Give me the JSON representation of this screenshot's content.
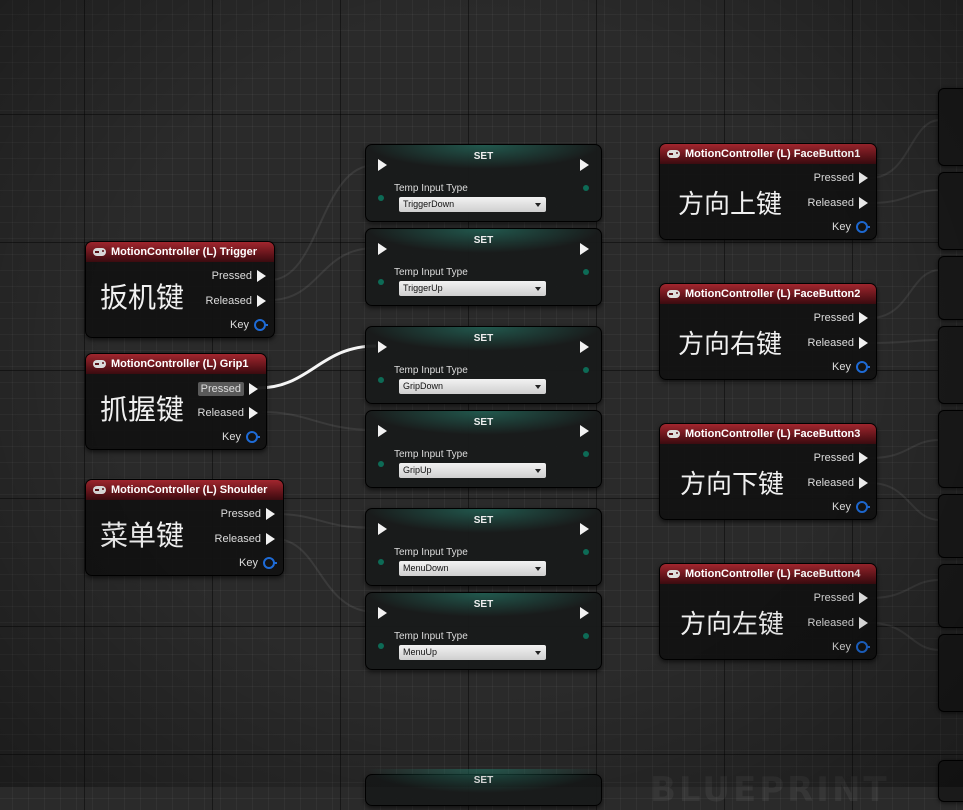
{
  "events": [
    {
      "title": "MotionController (L) Trigger",
      "comment": "扳机键",
      "pins": [
        "Pressed",
        "Released",
        "Key"
      ]
    },
    {
      "title": "MotionController (L) Grip1",
      "comment": "抓握键",
      "pins": [
        "Pressed",
        "Released",
        "Key"
      ]
    },
    {
      "title": "MotionController (L) Shoulder",
      "comment": "菜单键",
      "pins": [
        "Pressed",
        "Released",
        "Key"
      ]
    },
    {
      "title": "MotionController (L) FaceButton1",
      "comment": "方向上键",
      "pins": [
        "Pressed",
        "Released",
        "Key"
      ]
    },
    {
      "title": "MotionController (L) FaceButton2",
      "comment": "方向右键",
      "pins": [
        "Pressed",
        "Released",
        "Key"
      ]
    },
    {
      "title": "MotionController (L) FaceButton3",
      "comment": "方向下键",
      "pins": [
        "Pressed",
        "Released",
        "Key"
      ]
    },
    {
      "title": "MotionController (L) FaceButton4",
      "comment": "方向左键",
      "pins": [
        "Pressed",
        "Released",
        "Key"
      ]
    }
  ],
  "set_nodes": [
    {
      "title": "SET",
      "label": "Temp Input Type",
      "value": "TriggerDown"
    },
    {
      "title": "SET",
      "label": "Temp Input Type",
      "value": "TriggerUp"
    },
    {
      "title": "SET",
      "label": "Temp Input Type",
      "value": "GripDown"
    },
    {
      "title": "SET",
      "label": "Temp Input Type",
      "value": "GripUp"
    },
    {
      "title": "SET",
      "label": "Temp Input Type",
      "value": "MenuDown"
    },
    {
      "title": "SET",
      "label": "Temp Input Type",
      "value": "MenuUp"
    },
    {
      "title": "SET"
    }
  ],
  "watermark": "BLUEPRINT",
  "colors": {
    "event_header": "#a2262e",
    "exec_pin": "#f2f2f2",
    "key_pin": "#1e6bd6",
    "set_glow": "#288c78",
    "data_pin": "#0d6b56"
  }
}
